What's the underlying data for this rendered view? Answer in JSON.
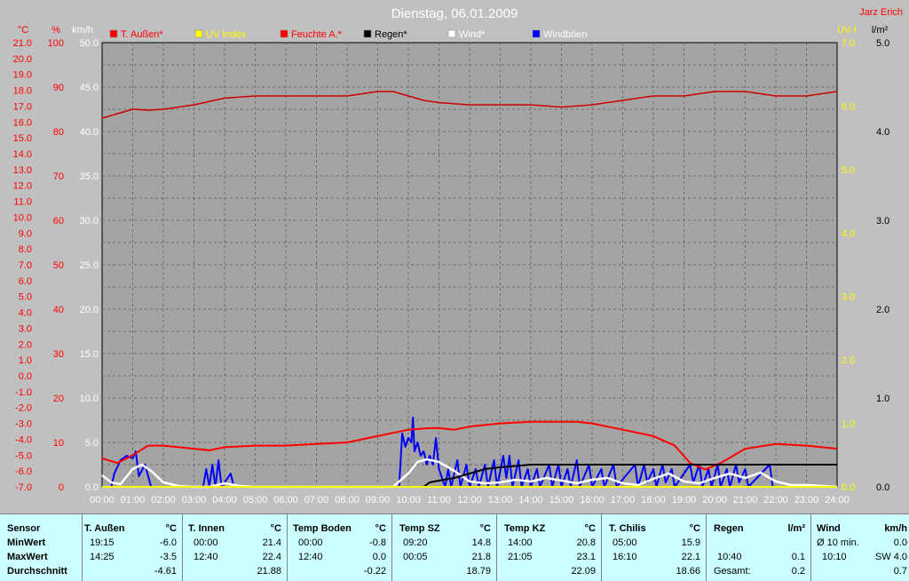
{
  "header": {
    "title": "Dienstag, 06.01.2009",
    "author": "Jarz Erich"
  },
  "axes": {
    "unit_temp": "°C",
    "unit_pct": "%",
    "unit_kmh": "km/h",
    "unit_uv": "UV-I",
    "unit_rain": "l/m²",
    "temp_ticks": [
      "21.0",
      "20.0",
      "19.0",
      "18.0",
      "17.0",
      "16.0",
      "15.0",
      "14.0",
      "13.0",
      "12.0",
      "11.0",
      "10.0",
      "9.0",
      "8.0",
      "7.0",
      "6.0",
      "5.0",
      "4.0",
      "3.0",
      "2.0",
      "1.0",
      "0.0",
      "-1.0",
      "-2.0",
      "-3.0",
      "-4.0",
      "-5.0",
      "-6.0",
      "-7.0"
    ],
    "pct_ticks": [
      "100",
      "90",
      "80",
      "70",
      "60",
      "50",
      "40",
      "30",
      "20",
      "10",
      "0"
    ],
    "kmh_ticks": [
      "50.0",
      "45.0",
      "40.0",
      "35.0",
      "30.0",
      "25.0",
      "20.0",
      "15.0",
      "10.0",
      "5.0",
      "0.0"
    ],
    "uv_ticks": [
      "7.0",
      "6.0",
      "5.0",
      "4.0",
      "3.0",
      "2.0",
      "1.0",
      "0.0"
    ],
    "rain_ticks": [
      "5.0",
      "4.0",
      "3.0",
      "2.0",
      "1.0",
      "0.0"
    ],
    "x_ticks": [
      "00:00",
      "01:00",
      "02:00",
      "03:00",
      "04:00",
      "05:00",
      "06:00",
      "07:00",
      "08:00",
      "09:00",
      "10:00",
      "11:00",
      "12:00",
      "13:00",
      "14:00",
      "15:00",
      "16:00",
      "17:00",
      "18:00",
      "19:00",
      "20:00",
      "21:00",
      "22:00",
      "23:00",
      "24:00"
    ]
  },
  "legend": [
    {
      "label": "T. Außen*",
      "color": "#ff0000",
      "text_color": "#ff0000"
    },
    {
      "label": "UV Index",
      "color": "#ffff00",
      "text_color": "#ffff00"
    },
    {
      "label": "Feuchte A.*",
      "color": "#ff0000",
      "text_color": "#ff0000"
    },
    {
      "label": "Regen*",
      "color": "#000000",
      "text_color": "#000000"
    },
    {
      "label": "Wind*",
      "color": "#ffffff",
      "text_color": "#ffffff"
    },
    {
      "label": "Windböen",
      "color": "#0000ff",
      "text_color": "#ffffff"
    }
  ],
  "colors": {
    "temp": "#ff0000",
    "hum": "#cc0000",
    "rain": "#000000",
    "wind": "#ffffff",
    "gust": "#0000ff",
    "uv": "#ffff00",
    "plot_bg": "#a4a4a4",
    "grid": "#6e6e6e"
  },
  "chart_data": {
    "type": "line",
    "title": "Dienstag, 06.01.2009",
    "x_unit": "hours",
    "xlim": [
      0,
      24
    ],
    "series": [
      {
        "name": "T. Außen*",
        "axis": "°C",
        "ylim": [
          -7,
          21
        ],
        "points": [
          [
            0,
            -5.2
          ],
          [
            0.5,
            -5.5
          ],
          [
            1,
            -5.0
          ],
          [
            1.5,
            -4.4
          ],
          [
            2,
            -4.4
          ],
          [
            3,
            -4.6
          ],
          [
            3.5,
            -4.7
          ],
          [
            4,
            -4.5
          ],
          [
            5,
            -4.4
          ],
          [
            6,
            -4.4
          ],
          [
            7,
            -4.3
          ],
          [
            8,
            -4.2
          ],
          [
            9,
            -3.8
          ],
          [
            9.5,
            -3.6
          ],
          [
            10,
            -3.4
          ],
          [
            10.7,
            -3.3
          ],
          [
            11,
            -3.3
          ],
          [
            11.5,
            -3.4
          ],
          [
            12,
            -3.2
          ],
          [
            13,
            -3.0
          ],
          [
            14,
            -2.9
          ],
          [
            15,
            -2.9
          ],
          [
            15.5,
            -2.9
          ],
          [
            16,
            -3.0
          ],
          [
            17,
            -3.4
          ],
          [
            18,
            -3.8
          ],
          [
            18.7,
            -4.4
          ],
          [
            19.2,
            -5.5
          ],
          [
            19.7,
            -5.9
          ],
          [
            20.2,
            -5.5
          ],
          [
            21,
            -4.6
          ],
          [
            22,
            -4.3
          ],
          [
            23,
            -4.4
          ],
          [
            24,
            -4.6
          ]
        ]
      },
      {
        "name": "Feuchte A.*",
        "axis": "%",
        "ylim": [
          0,
          100
        ],
        "points": [
          [
            0,
            83
          ],
          [
            0.5,
            84
          ],
          [
            1,
            85
          ],
          [
            1.5,
            84.8
          ],
          [
            2,
            85
          ],
          [
            3,
            86
          ],
          [
            4,
            87.5
          ],
          [
            5,
            88
          ],
          [
            6,
            88
          ],
          [
            7,
            88
          ],
          [
            8,
            88
          ],
          [
            9,
            89
          ],
          [
            9.5,
            89
          ],
          [
            10,
            88
          ],
          [
            10.5,
            87
          ],
          [
            11,
            86.5
          ],
          [
            12,
            86
          ],
          [
            13,
            86
          ],
          [
            14,
            86
          ],
          [
            15,
            85.5
          ],
          [
            16,
            86
          ],
          [
            17,
            87
          ],
          [
            18,
            88
          ],
          [
            19,
            88
          ],
          [
            20,
            89
          ],
          [
            21,
            89
          ],
          [
            22,
            88
          ],
          [
            23,
            88
          ],
          [
            24,
            89
          ]
        ]
      },
      {
        "name": "Regen*",
        "axis": "l/m²",
        "ylim": [
          0,
          5
        ],
        "points": [
          [
            0,
            0
          ],
          [
            10.5,
            0
          ],
          [
            10.7,
            0.05
          ],
          [
            11,
            0.07
          ],
          [
            11.5,
            0.1
          ],
          [
            12,
            0.15
          ],
          [
            12.5,
            0.2
          ],
          [
            13,
            0.22
          ],
          [
            14,
            0.25
          ],
          [
            24,
            0.25
          ]
        ]
      },
      {
        "name": "Wind*",
        "axis": "km/h",
        "ylim": [
          0,
          50
        ],
        "points": [
          [
            0,
            1.3
          ],
          [
            0.3,
            0.5
          ],
          [
            0.6,
            0.3
          ],
          [
            1,
            2.0
          ],
          [
            1.3,
            2.5
          ],
          [
            1.6,
            1.8
          ],
          [
            2,
            0.5
          ],
          [
            2.5,
            0.1
          ],
          [
            3,
            0
          ],
          [
            3.5,
            0
          ],
          [
            4,
            0.4
          ],
          [
            4.5,
            0.1
          ],
          [
            5,
            0
          ],
          [
            9.5,
            0
          ],
          [
            10,
            1.5
          ],
          [
            10.3,
            2.8
          ],
          [
            10.6,
            3.1
          ],
          [
            11,
            2.8
          ],
          [
            11.5,
            1.8
          ],
          [
            12,
            0.6
          ],
          [
            12.5,
            0.4
          ],
          [
            13,
            0.5
          ],
          [
            13.5,
            0.8
          ],
          [
            14,
            0.6
          ],
          [
            14.5,
            1.0
          ],
          [
            15,
            0.7
          ],
          [
            15.5,
            0.4
          ],
          [
            16,
            0.8
          ],
          [
            16.5,
            1.0
          ],
          [
            17,
            0.4
          ],
          [
            17.5,
            0.2
          ],
          [
            18,
            0.9
          ],
          [
            18.5,
            1.5
          ],
          [
            19,
            0.6
          ],
          [
            19.5,
            0.4
          ],
          [
            20,
            1.0
          ],
          [
            20.5,
            1.5
          ],
          [
            21,
            1.0
          ],
          [
            21.5,
            1.6
          ],
          [
            22,
            0.6
          ],
          [
            22.5,
            0.2
          ],
          [
            23,
            0.2
          ],
          [
            24,
            0
          ]
        ]
      },
      {
        "name": "Windböen",
        "axis": "km/h",
        "ylim": [
          0,
          50
        ],
        "points": [
          [
            0,
            0
          ],
          [
            0.3,
            0
          ],
          [
            0.4,
            1.5
          ],
          [
            0.6,
            3.0
          ],
          [
            0.8,
            3.5
          ],
          [
            1,
            3.2
          ],
          [
            1.1,
            4.0
          ],
          [
            1.2,
            1.2
          ],
          [
            1.4,
            2.5
          ],
          [
            1.6,
            0
          ],
          [
            3.3,
            0
          ],
          [
            3.4,
            2.0
          ],
          [
            3.5,
            0
          ],
          [
            3.6,
            2.5
          ],
          [
            3.7,
            0
          ],
          [
            3.8,
            3.0
          ],
          [
            3.9,
            0
          ],
          [
            4.2,
            1.5
          ],
          [
            4.3,
            0
          ],
          [
            9.7,
            0
          ],
          [
            9.8,
            6.0
          ],
          [
            9.9,
            4.5
          ],
          [
            10,
            5.5
          ],
          [
            10.1,
            5.0
          ],
          [
            10.15,
            7.8
          ],
          [
            10.2,
            4.0
          ],
          [
            10.3,
            5.0
          ],
          [
            10.4,
            3.5
          ],
          [
            10.5,
            4.0
          ],
          [
            10.6,
            2.5
          ],
          [
            10.7,
            3.5
          ],
          [
            10.8,
            2.5
          ],
          [
            10.9,
            5.5
          ],
          [
            11,
            2.0
          ],
          [
            11.2,
            0
          ],
          [
            11.3,
            2.0
          ],
          [
            11.4,
            0
          ],
          [
            11.6,
            3.0
          ],
          [
            11.7,
            0
          ],
          [
            11.9,
            2.5
          ],
          [
            12,
            0
          ],
          [
            12.2,
            2.0
          ],
          [
            12.3,
            0
          ],
          [
            12.5,
            2.5
          ],
          [
            12.6,
            0
          ],
          [
            12.8,
            3.0
          ],
          [
            12.9,
            0
          ],
          [
            13.1,
            3.5
          ],
          [
            13.2,
            1.0
          ],
          [
            13.3,
            3.5
          ],
          [
            13.4,
            0
          ],
          [
            13.6,
            3.0
          ],
          [
            13.7,
            0
          ],
          [
            13.9,
            2.0
          ],
          [
            14,
            0
          ],
          [
            14.2,
            2.0
          ],
          [
            14.3,
            0
          ],
          [
            14.6,
            2.5
          ],
          [
            14.7,
            0
          ],
          [
            14.9,
            2.5
          ],
          [
            15,
            0
          ],
          [
            15.2,
            2.0
          ],
          [
            15.3,
            0
          ],
          [
            15.5,
            3.0
          ],
          [
            15.6,
            0
          ],
          [
            15.9,
            2.5
          ],
          [
            16,
            0
          ],
          [
            16.3,
            2.0
          ],
          [
            16.4,
            0
          ],
          [
            16.7,
            2.5
          ],
          [
            16.8,
            0
          ],
          [
            17.4,
            2.5
          ],
          [
            17.5,
            0
          ],
          [
            17.7,
            2.5
          ],
          [
            17.8,
            0.5
          ],
          [
            18,
            2.0
          ],
          [
            18.1,
            0
          ],
          [
            18.3,
            2.5
          ],
          [
            18.4,
            0.5
          ],
          [
            18.6,
            2.0
          ],
          [
            18.7,
            0
          ],
          [
            19.2,
            2.5
          ],
          [
            19.3,
            0.5
          ],
          [
            19.5,
            2.5
          ],
          [
            19.6,
            0
          ],
          [
            19.8,
            2.0
          ],
          [
            19.9,
            0
          ],
          [
            20.1,
            2.5
          ],
          [
            20.2,
            0
          ],
          [
            20.4,
            2.0
          ],
          [
            20.5,
            0
          ],
          [
            20.7,
            2.5
          ],
          [
            20.8,
            0.5
          ],
          [
            21,
            2.0
          ],
          [
            21.1,
            0
          ],
          [
            21.8,
            2.5
          ],
          [
            21.9,
            0
          ],
          [
            24,
            0
          ]
        ]
      },
      {
        "name": "UV Index",
        "axis": "UV-I",
        "ylim": [
          0,
          7
        ],
        "points": [
          [
            0,
            0
          ],
          [
            24,
            0
          ]
        ]
      }
    ]
  },
  "stats": {
    "sensor_header": "Sensor",
    "min_label": "MinWert",
    "max_label": "MaxWert",
    "avg_label": "Durchschnitt",
    "t_aussen": {
      "name": "T. Außen",
      "unit": "°C",
      "min_time": "19:15",
      "min": "-6.0",
      "max_time": "14:25",
      "max": "-3.5",
      "avg": "-4.61"
    },
    "t_innen": {
      "name": "T. Innen",
      "unit": "°C",
      "min_time": "00:00",
      "min": "21.4",
      "max_time": "12:40",
      "max": "22.4",
      "avg": "21.88"
    },
    "t_boden": {
      "name": "Temp Boden",
      "unit": "°C",
      "min_time": "00:00",
      "min": "-0.8",
      "max_time": "12:40",
      "max": "0.0",
      "avg": "-0.22"
    },
    "t_sz": {
      "name": "Temp SZ",
      "unit": "°C",
      "min_time": "09:20",
      "min": "14.8",
      "max_time": "00:05",
      "max": "21.8",
      "avg": "18.79"
    },
    "t_kz": {
      "name": "Temp KZ",
      "unit": "°C",
      "min_time": "14:00",
      "min": "20.8",
      "max_time": "21:05",
      "max": "23.1",
      "avg": "22.09"
    },
    "t_chilis": {
      "name": "T. Chilis",
      "unit": "°C",
      "min_time": "05:00",
      "min": "15.9",
      "max_time": "16:10",
      "max": "22.1",
      "avg": "18.66"
    },
    "regen": {
      "name": "Regen",
      "unit": "l/m²",
      "min_time": "",
      "min": "",
      "max_time": "10:40",
      "max": "0.1",
      "avg_label": "Gesamt:",
      "avg": "0.2"
    },
    "wind": {
      "name": "Wind",
      "unit": "km/h",
      "min_label": "Ø 10 min.",
      "min": "0.0",
      "max_time": "10:10",
      "max": "SW 4.0",
      "avg": "0.7"
    }
  }
}
